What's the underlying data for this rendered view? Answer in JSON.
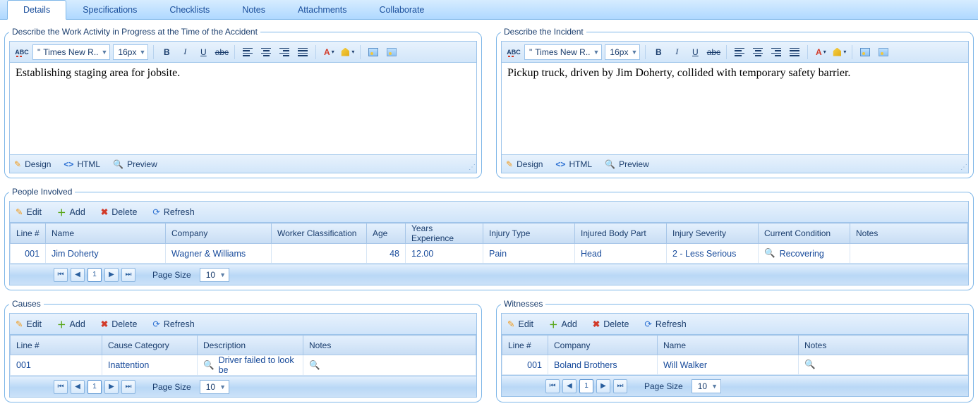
{
  "tabs": [
    {
      "label": "Details",
      "active": true
    },
    {
      "label": "Specifications"
    },
    {
      "label": "Checklists"
    },
    {
      "label": "Notes"
    },
    {
      "label": "Attachments"
    },
    {
      "label": "Collaborate"
    }
  ],
  "editorCommon": {
    "fontName": "Times New R..",
    "fontSize": "16px",
    "tabs": {
      "design": "Design",
      "html": "HTML",
      "preview": "Preview"
    }
  },
  "workActivity": {
    "legend": "Describe the Work Activity in Progress at the Time of the Accident",
    "content": "Establishing staging area for jobsite."
  },
  "incident": {
    "legend": "Describe the Incident",
    "content": "Pickup truck, driven by Jim Doherty, collided with temporary safety barrier."
  },
  "gridToolbar": {
    "edit": "Edit",
    "add": "Add",
    "delete": "Delete",
    "refresh": "Refresh"
  },
  "pager": {
    "sizeLabel": "Page Size",
    "sizeValue": "10",
    "page": "1"
  },
  "people": {
    "legend": "People Involved",
    "headers": {
      "line": "Line #",
      "name": "Name",
      "company": "Company",
      "wclass": "Worker Classification",
      "age": "Age",
      "years": "Years Experience",
      "injuryType": "Injury Type",
      "bodyPart": "Injured Body Part",
      "severity": "Injury Severity",
      "condition": "Current Condition",
      "notes": "Notes"
    },
    "rows": [
      {
        "line": "001",
        "name": "Jim Doherty",
        "company": "Wagner & Williams",
        "wclass": "",
        "age": "48",
        "years": "12.00",
        "injuryType": "Pain",
        "bodyPart": "Head",
        "severity": "2 - Less Serious",
        "condition": "Recovering",
        "notes": ""
      }
    ]
  },
  "causes": {
    "legend": "Causes",
    "headers": {
      "line": "Line #",
      "category": "Cause Category",
      "desc": "Description",
      "notes": "Notes"
    },
    "rows": [
      {
        "line": "001",
        "category": "Inattention",
        "desc": "Driver failed to look be",
        "notes": ""
      }
    ]
  },
  "witnesses": {
    "legend": "Witnesses",
    "headers": {
      "line": "Line #",
      "company": "Company",
      "name": "Name",
      "notes": "Notes"
    },
    "rows": [
      {
        "line": "001",
        "company": "Boland Brothers",
        "name": "Will Walker",
        "notes": ""
      }
    ]
  }
}
